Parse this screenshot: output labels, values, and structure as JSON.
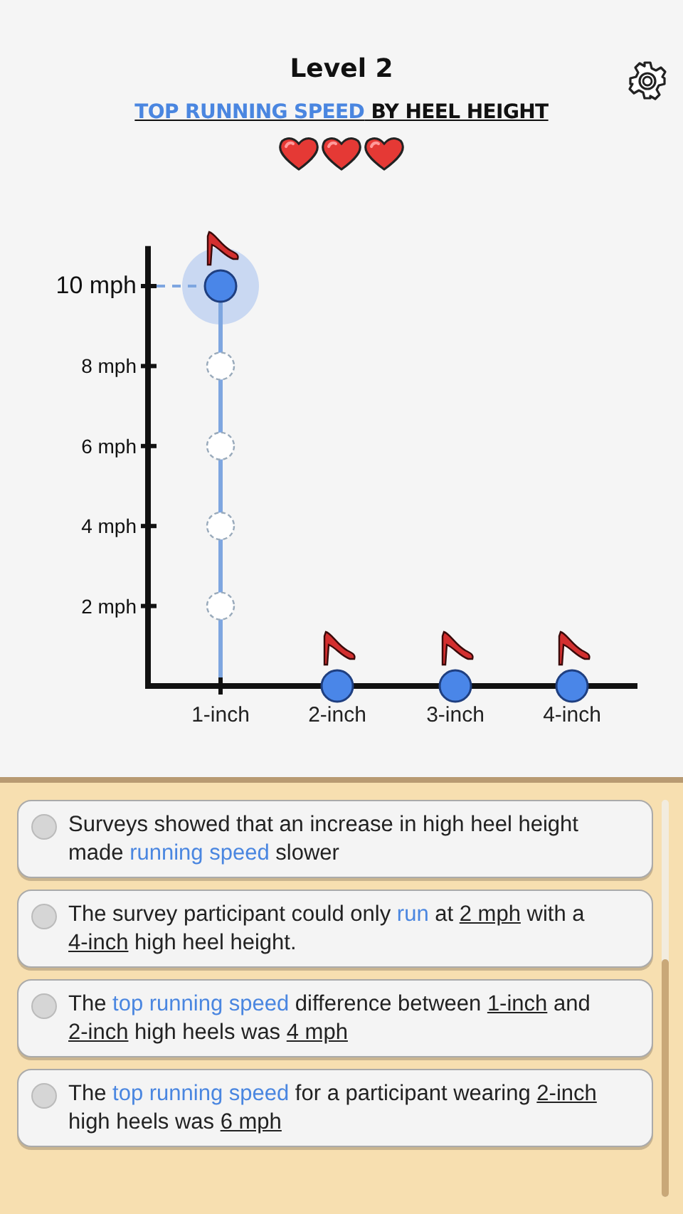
{
  "header": {
    "title": "Level 2",
    "subtitle": [
      {
        "text": "TOP RUNNING SPEED",
        "kind": "term"
      },
      {
        "text": " BY HEEL HEIGHT",
        "kind": "plain"
      }
    ],
    "stars": 3
  },
  "chart_data": {
    "type": "scatter",
    "categories": [
      "1-inch",
      "2-inch",
      "3-inch",
      "4-inch"
    ],
    "values": [
      10,
      0,
      0,
      0
    ],
    "ylim": [
      0,
      11
    ],
    "yticks": [
      {
        "value": 2,
        "label": "2 mph"
      },
      {
        "value": 4,
        "label": "4 mph"
      },
      {
        "value": 6,
        "label": "6 mph"
      },
      {
        "value": 8,
        "label": "8 mph"
      },
      {
        "value": 10,
        "label": "10 mph"
      }
    ]
  },
  "handles": [
    {
      "selected": true
    },
    {
      "selected": false
    },
    {
      "selected": false
    },
    {
      "selected": false
    }
  ],
  "options": [
    {
      "selected": false,
      "segments": [
        {
          "text": "Surveys showed that an increase in high heel height made ",
          "kind": "plain"
        },
        {
          "text": "running speed",
          "kind": "term"
        },
        {
          "text": " slower",
          "kind": "plain"
        }
      ]
    },
    {
      "selected": false,
      "segments": [
        {
          "text": "The survey participant could only ",
          "kind": "plain"
        },
        {
          "text": "run",
          "kind": "term"
        },
        {
          "text": " at ",
          "kind": "plain"
        },
        {
          "text": "2 mph",
          "kind": "blank"
        },
        {
          "text": " with a ",
          "kind": "plain"
        },
        {
          "text": "4-inch",
          "kind": "blank"
        },
        {
          "text": " high heel height.",
          "kind": "plain"
        }
      ]
    },
    {
      "selected": false,
      "segments": [
        {
          "text": "The ",
          "kind": "plain"
        },
        {
          "text": "top running speed",
          "kind": "term"
        },
        {
          "text": " difference between ",
          "kind": "plain"
        },
        {
          "text": "1-inch",
          "kind": "blank"
        },
        {
          "text": " and ",
          "kind": "plain"
        },
        {
          "text": "2-inch",
          "kind": "blank"
        },
        {
          "text": " high heels was ",
          "kind": "plain"
        },
        {
          "text": "4 mph",
          "kind": "blank"
        }
      ]
    },
    {
      "selected": false,
      "segments": [
        {
          "text": "The ",
          "kind": "plain"
        },
        {
          "text": "top running speed",
          "kind": "term"
        },
        {
          "text": " for a participant wearing ",
          "kind": "plain"
        },
        {
          "text": "2-inch",
          "kind": "blank"
        },
        {
          "text": " high heels was ",
          "kind": "plain"
        },
        {
          "text": "6 mph",
          "kind": "blank"
        }
      ]
    }
  ]
}
